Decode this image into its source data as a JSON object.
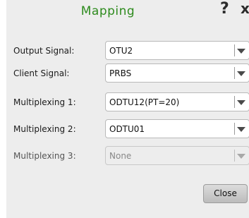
{
  "dialog": {
    "title": "Mapping",
    "help_icon": "question-mark",
    "close_icon": "x",
    "close_button_label": "Close"
  },
  "fields": [
    {
      "label": "Output Signal:",
      "value": "OTU2",
      "enabled": true
    },
    {
      "label": "Client Signal:",
      "value": "PRBS",
      "enabled": true
    },
    {
      "label": "Multiplexing 1:",
      "value": "ODTU12(PT=20)",
      "enabled": true
    },
    {
      "label": "Multiplexing 2:",
      "value": "ODTU01",
      "enabled": true
    },
    {
      "label": "Multiplexing 3:",
      "value": "None",
      "enabled": false
    }
  ]
}
